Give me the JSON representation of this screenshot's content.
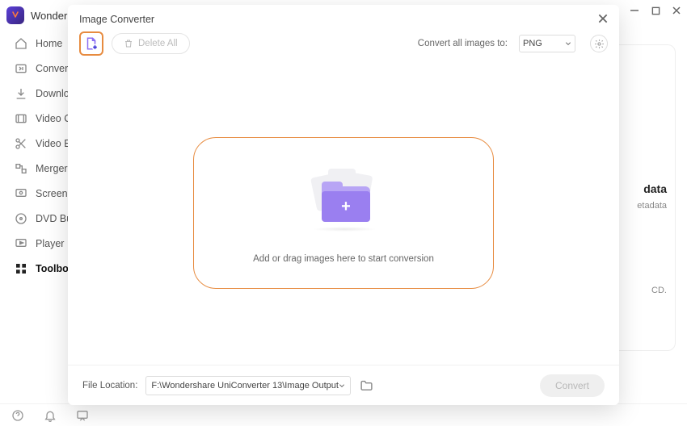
{
  "app": {
    "title": "Wonder"
  },
  "sidebar": {
    "items": [
      {
        "label": "Home"
      },
      {
        "label": "Converte"
      },
      {
        "label": "Downloa"
      },
      {
        "label": "Video C"
      },
      {
        "label": "Video E"
      },
      {
        "label": "Merger"
      },
      {
        "label": "Screen F"
      },
      {
        "label": "DVD Bu"
      },
      {
        "label": "Player"
      },
      {
        "label": "Toolbox"
      }
    ]
  },
  "background_panel": {
    "line1": "data",
    "line2": "etadata",
    "line3": "CD."
  },
  "dialog": {
    "title": "Image Converter",
    "delete_all_label": "Delete All",
    "convert_all_label": "Convert all images to:",
    "format_selected": "PNG",
    "drop_text": "Add or drag images here to start conversion",
    "file_location_label": "File Location:",
    "file_location_value": "F:\\Wondershare UniConverter 13\\Image Output",
    "convert_button": "Convert"
  }
}
